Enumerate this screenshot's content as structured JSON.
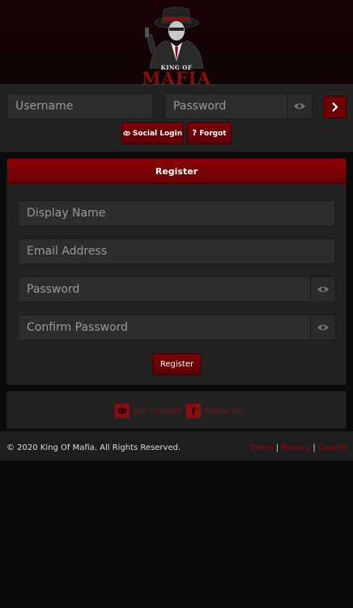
{
  "brand": {
    "logo_small": "KING OF",
    "logo_big": "MAFIA"
  },
  "login": {
    "username_placeholder": "Username",
    "password_placeholder": "Password",
    "social_login_label": "Social Login",
    "forgot_label": "Forgot"
  },
  "register": {
    "title": "Register",
    "display_name_placeholder": "Display Name",
    "email_placeholder": "Email Address",
    "password_placeholder": "Password",
    "confirm_password_placeholder": "Confirm Password",
    "submit_label": "Register"
  },
  "social": {
    "discord_label": "Join Discord",
    "facebook_label": "Follow Us"
  },
  "footer": {
    "copyright": "© 2020 King Of Mafia. All Rights Reserved.",
    "links": [
      "Terms",
      "Privacy",
      "Credits"
    ],
    "separator": "|"
  },
  "colors": {
    "accent": "#8a0d10",
    "button": "#6e0003",
    "panel": "#222222",
    "input": "#2d2d2d"
  }
}
